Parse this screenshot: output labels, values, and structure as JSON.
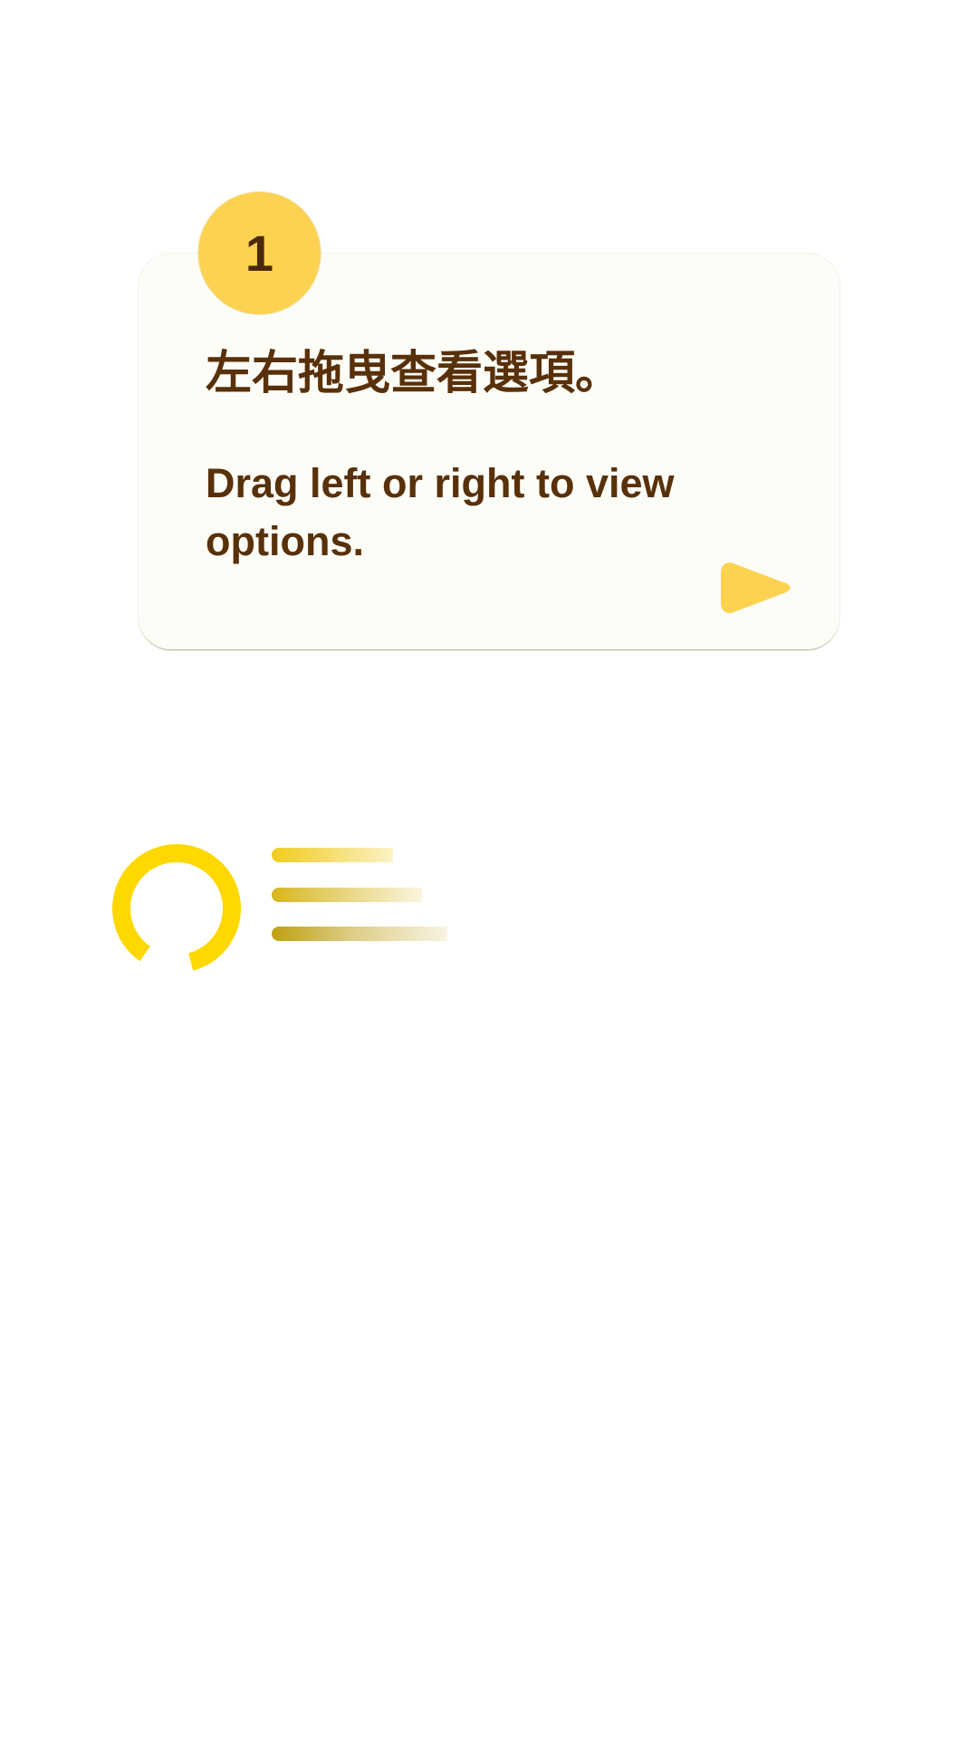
{
  "onboarding": {
    "step_number": "1",
    "hint_zh": "左右拖曳查看選項。",
    "hint_en": "Drag left or right to view options.",
    "next_icon": "play-arrow-icon"
  },
  "loading": {
    "spinner_icon": "loading-ring-icon",
    "placeholder_icon": "skeleton-lines-icon"
  },
  "colors": {
    "accent_yellow": "#fdd250",
    "text_brown": "#58300a",
    "card_background": "#fdfdf7",
    "spinner_yellow": "#ffd800"
  }
}
